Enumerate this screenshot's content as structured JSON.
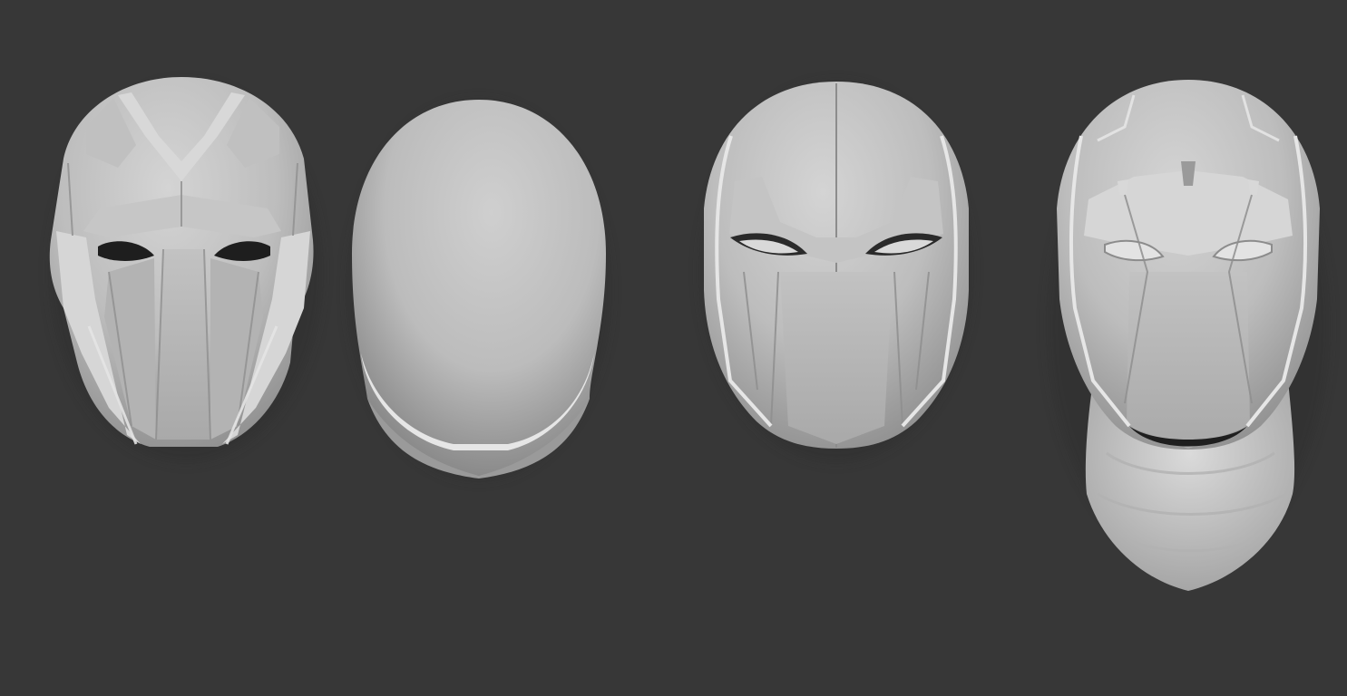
{
  "scene": {
    "background": "#373737",
    "model_base_color": "#c9c9c9",
    "models": [
      {
        "id": "armored-visor-helmet",
        "label": ""
      },
      {
        "id": "blank-hood",
        "label": ""
      },
      {
        "id": "paneled-center-seam-helmet",
        "label": ""
      },
      {
        "id": "helmet-with-neck-cowl",
        "label": ""
      }
    ]
  }
}
